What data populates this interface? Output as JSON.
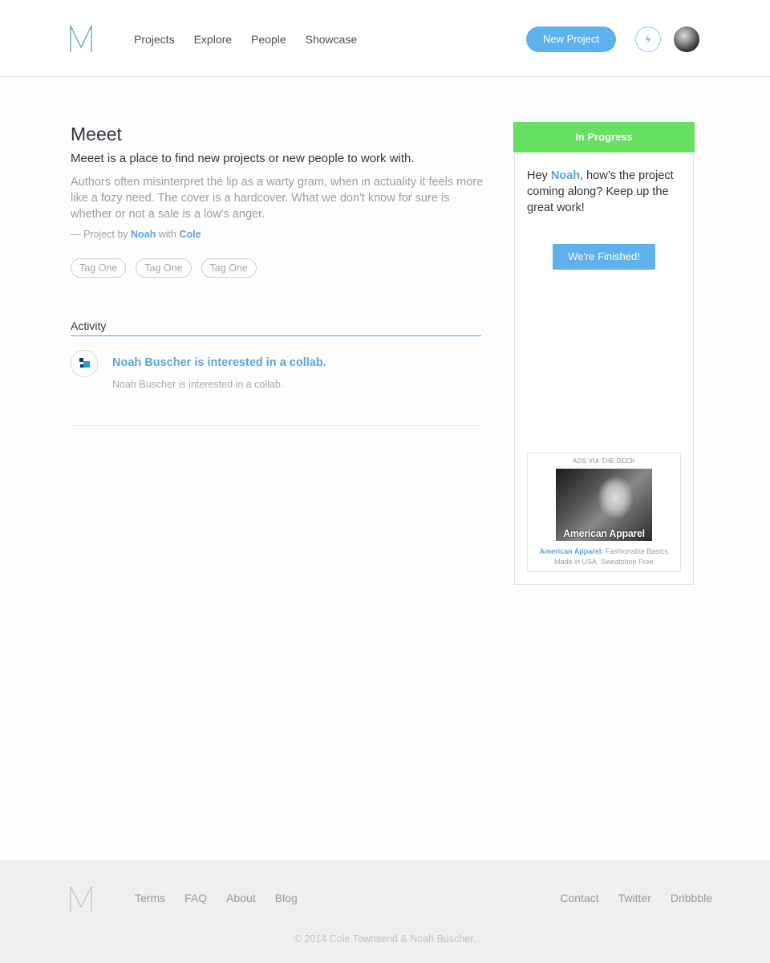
{
  "header": {
    "logo_letter": "M",
    "nav": [
      "Projects",
      "Explore",
      "People",
      "Showcase"
    ],
    "new_project_label": "New Project",
    "notifications_icon": "bolt-icon",
    "avatar_icon": "user-avatar"
  },
  "project": {
    "title": "Meeet",
    "subtitle": "Meeet is a place to find new projects or new people to work with.",
    "description": "Authors often misinterpret the lip as a warty gram, when in actuality it feels more like a fozy need. The cover is a hardcover. What we don't know for sure is whether or not a sale is a low's anger.",
    "byline_prefix": "— Project by ",
    "byline_owner": "Noah",
    "byline_with": " with ",
    "byline_collab": "Cole",
    "tags": [
      "Tag One",
      "Tag One",
      "Tag One"
    ]
  },
  "activity": {
    "heading": "Activity",
    "items": [
      {
        "title": "Noah Buscher is interested in a collab.",
        "subtitle": "Noah Buscher is interested in a collab."
      }
    ]
  },
  "sidebar": {
    "status": "In Progress",
    "status_color": "#66e060",
    "greeting_prefix": "Hey ",
    "greeting_name": "Noah",
    "greeting_suffix": ", how’s the project coming along?  Keep up the great work!",
    "finish_label": "We're Finished!",
    "ad": {
      "header": "ADS VIA THE DECK",
      "image_text": "American Apparel",
      "caption_brand": "American Apparel:",
      "caption_text": " Fashionable Basics. Made in USA. Sweatshop Free."
    }
  },
  "footer": {
    "logo_letter": "M",
    "left_links": [
      "Terms",
      "FAQ",
      "About",
      "Blog"
    ],
    "right_links": [
      "Contact",
      "Twitter",
      "Dribbble"
    ],
    "copyright": "© 2014 Cole Townsend & Noah Buscher."
  },
  "colors": {
    "accent": "#5fb1ee",
    "link": "#5aa5e0",
    "success": "#66e060"
  }
}
